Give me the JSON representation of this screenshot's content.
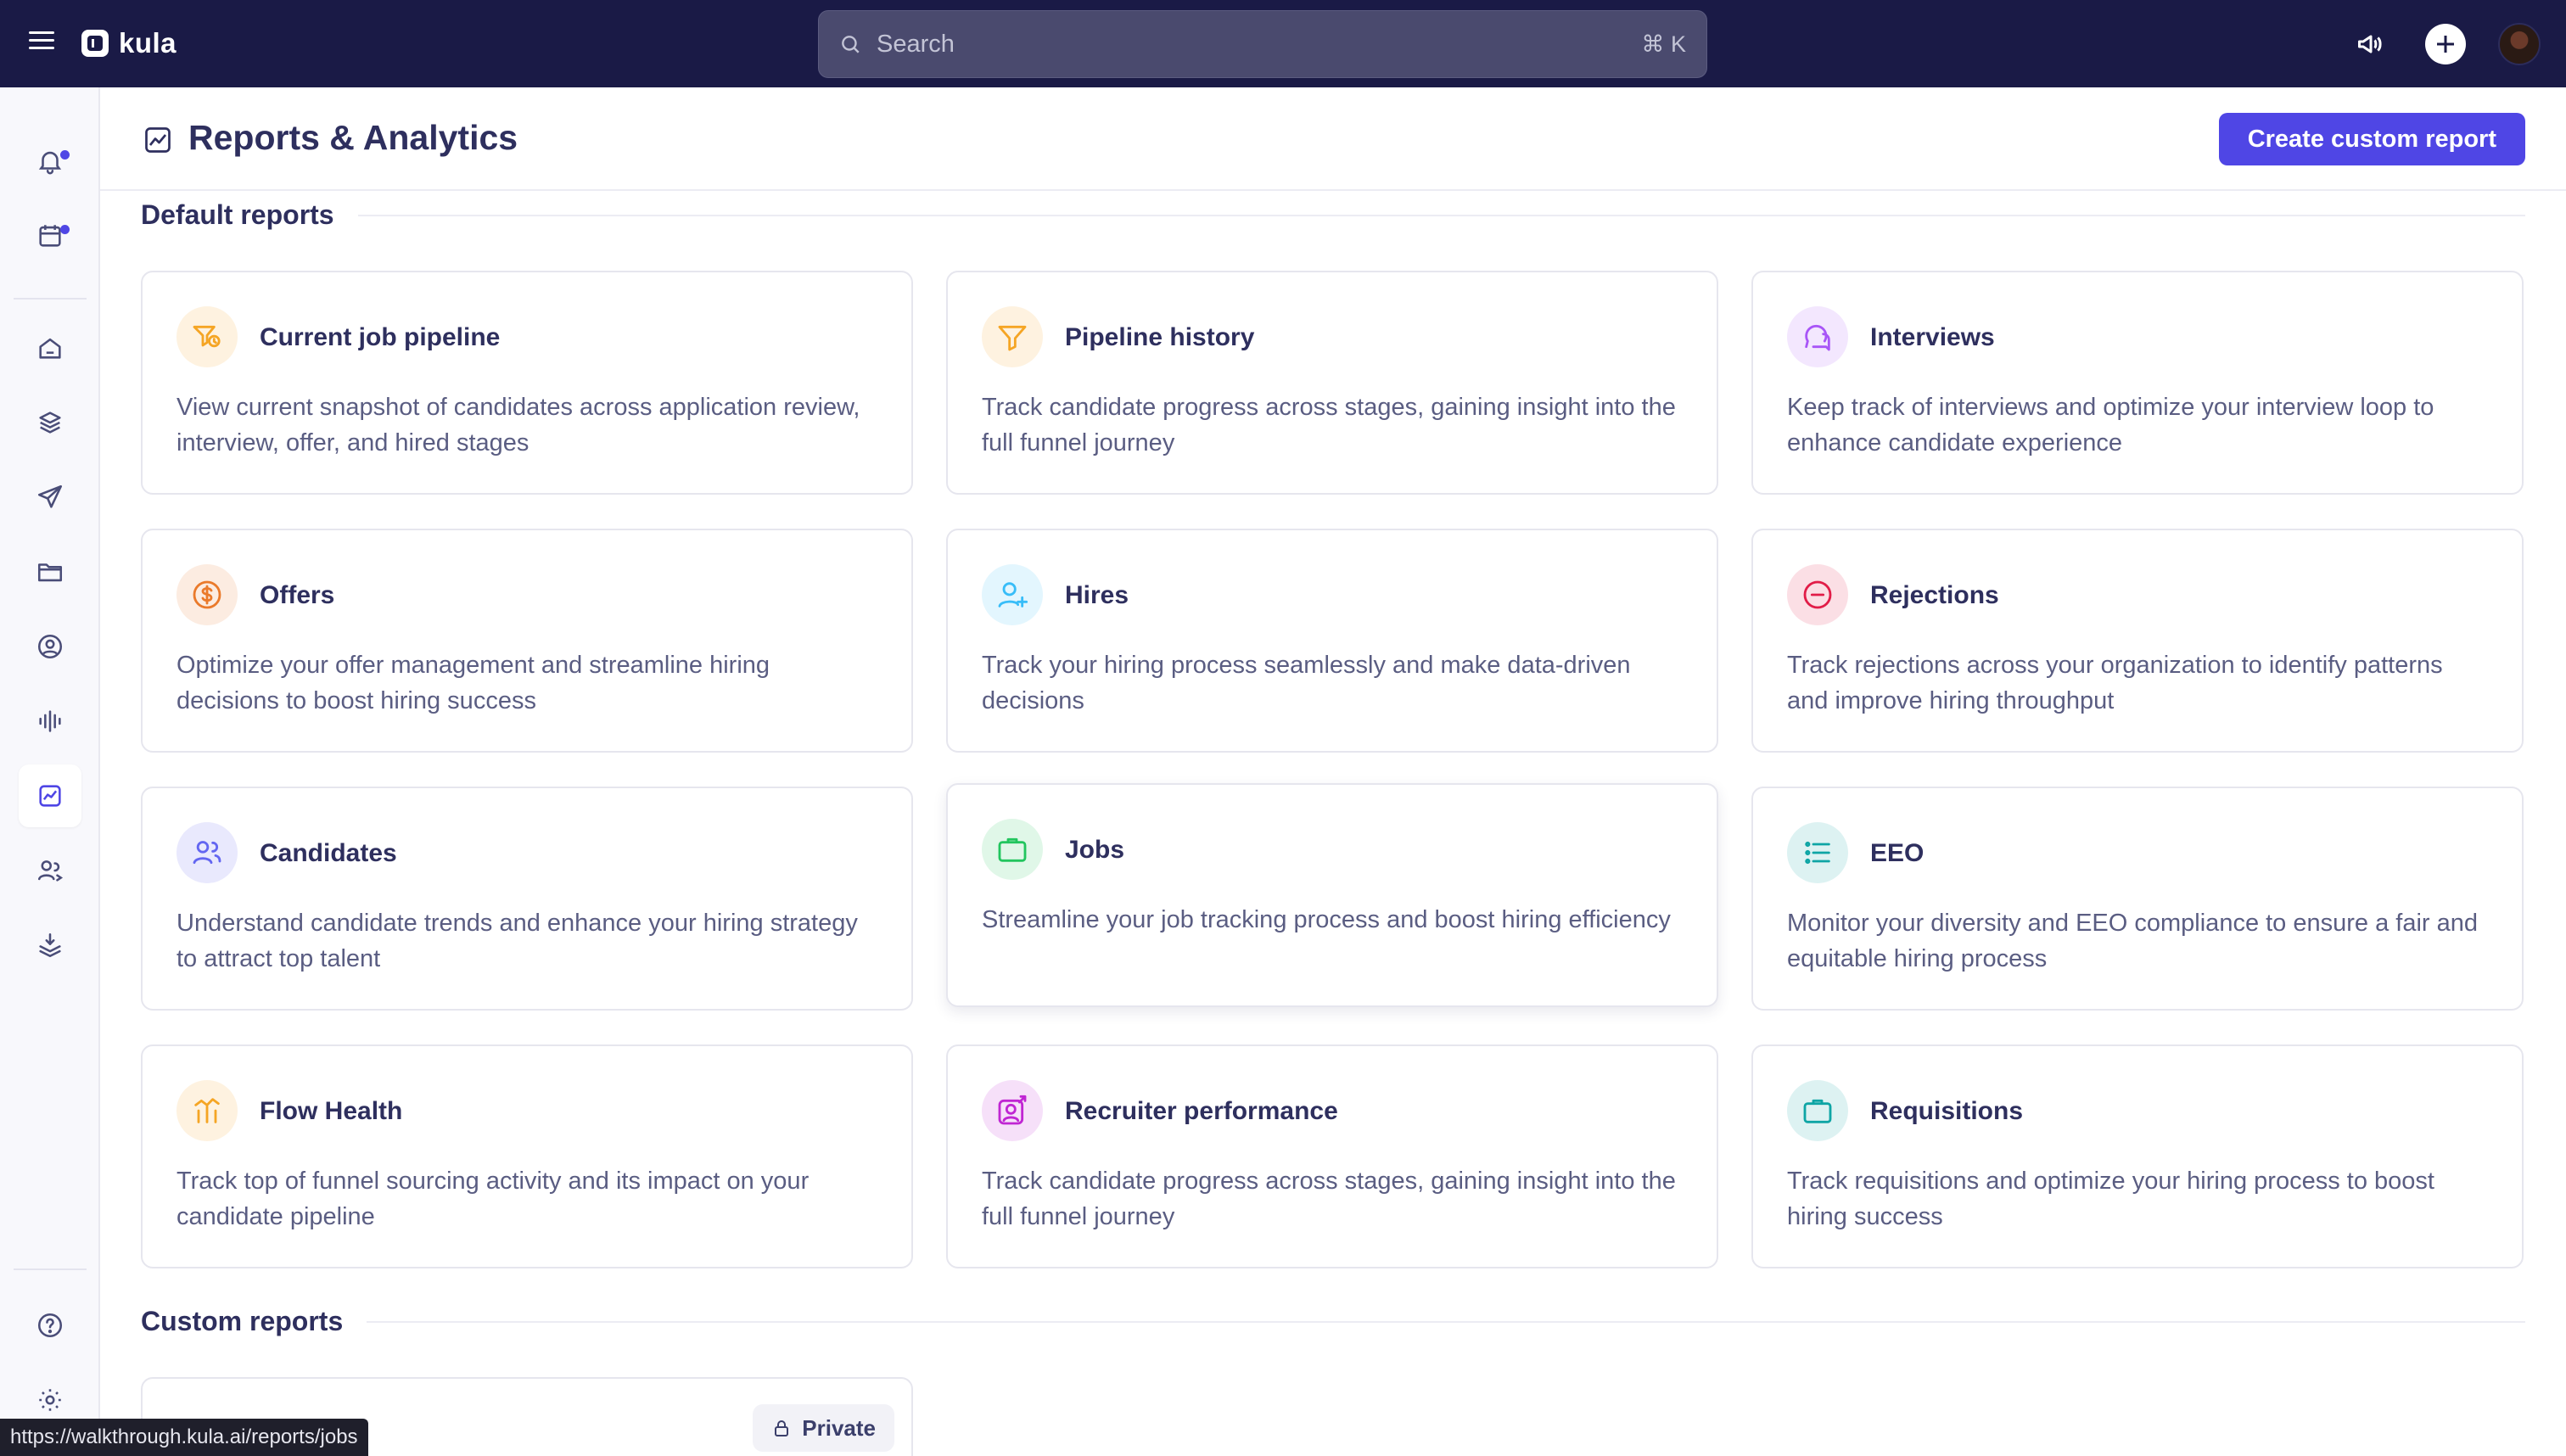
{
  "app": {
    "name": "kula"
  },
  "topbar": {
    "search_placeholder": "Search",
    "search_shortcut": "⌘ K"
  },
  "sidebar": {
    "items": [
      {
        "icon": "bell-icon",
        "dot": true
      },
      {
        "icon": "calendar-icon",
        "dot": true
      },
      {
        "icon": "home-icon"
      },
      {
        "icon": "layers-icon"
      },
      {
        "icon": "send-icon"
      },
      {
        "icon": "folder-icon"
      },
      {
        "icon": "user-circle-icon"
      },
      {
        "icon": "audio-wave-icon"
      },
      {
        "icon": "analytics-icon",
        "active": true
      },
      {
        "icon": "users-icon"
      },
      {
        "icon": "download-stack-icon"
      },
      {
        "icon": "help-icon"
      },
      {
        "icon": "gear-icon"
      }
    ]
  },
  "page": {
    "title": "Reports & Analytics",
    "create_button": "Create custom report"
  },
  "default_reports": {
    "heading": "Default reports",
    "cards": [
      {
        "title": "Current job pipeline",
        "desc": "View current snapshot of candidates across application review, interview, offer, and hired stages",
        "icon": "pipeline-icon",
        "color": "#f5a524"
      },
      {
        "title": "Pipeline history",
        "desc": "Track candidate progress across stages, gaining insight into the full funnel journey",
        "icon": "funnel-icon",
        "color": "#f5a524"
      },
      {
        "title": "Interviews",
        "desc": "Keep track of interviews and optimize your interview loop to enhance candidate experience",
        "icon": "chat-bubbles-icon",
        "color": "#a855f7"
      },
      {
        "title": "Offers",
        "desc": "Optimize your offer management and streamline hiring decisions to boost hiring success",
        "icon": "dollar-icon",
        "color": "#ea7a2b"
      },
      {
        "title": "Hires",
        "desc": "Track your hiring process seamlessly and make data-driven decisions",
        "icon": "user-plus-icon",
        "color": "#38bdf8"
      },
      {
        "title": "Rejections",
        "desc": "Track rejections across your organization to identify patterns and improve hiring throughput",
        "icon": "minus-circle-icon",
        "color": "#e11d48"
      },
      {
        "title": "Candidates",
        "desc": "Understand candidate trends and enhance your hiring strategy to attract top talent",
        "icon": "users-icon",
        "color": "#6366f1"
      },
      {
        "title": "Jobs",
        "desc": "Streamline your job tracking process and boost hiring efficiency",
        "icon": "briefcase-icon",
        "color": "#22c55e"
      },
      {
        "title": "EEO",
        "desc": "Monitor your diversity and EEO compliance to ensure a fair and equitable hiring process",
        "icon": "list-icon",
        "color": "#0ea5a5"
      },
      {
        "title": "Flow Health",
        "desc": "Track top of funnel sourcing activity and its impact on your candidate pipeline",
        "icon": "bars-arrow-icon",
        "color": "#f5a524"
      },
      {
        "title": "Recruiter performance",
        "desc": "Track candidate progress across stages, gaining insight into the full funnel journey",
        "icon": "recruiter-icon",
        "color": "#c026d3"
      },
      {
        "title": "Requisitions",
        "desc": "Track requisitions and optimize your hiring process to boost hiring success",
        "icon": "briefcase-icon",
        "color": "#0ea5a5"
      }
    ]
  },
  "custom_reports": {
    "heading": "Custom reports",
    "private_label": "Private"
  },
  "status_bar": {
    "url": "https://walkthrough.kula.ai/reports/jobs"
  }
}
